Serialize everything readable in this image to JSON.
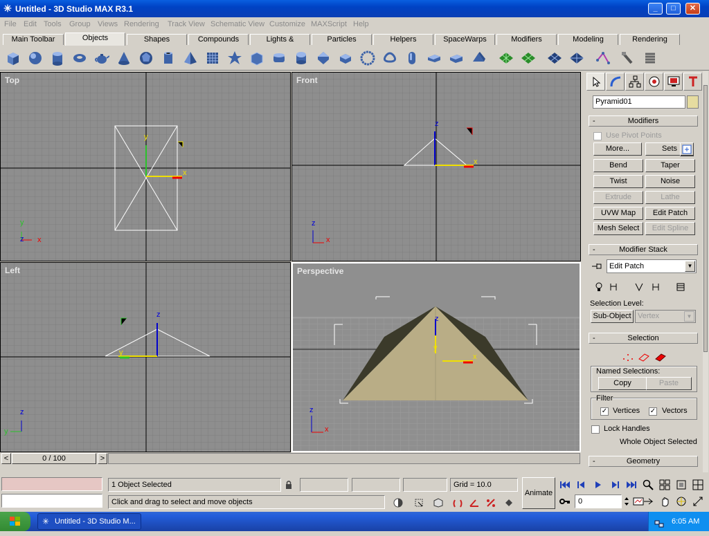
{
  "window": {
    "title": "Untitled - 3D Studio MAX R3.1",
    "minimize": "_",
    "maximize": "□",
    "close": "✕"
  },
  "menu": [
    "File",
    "Edit",
    "Tools",
    "Group",
    "Views",
    "Rendering",
    "Track View",
    "Schematic View",
    "Customize",
    "MAXScript",
    "Help"
  ],
  "tabs": [
    "Main Toolbar",
    "Objects",
    "Shapes",
    "Compounds",
    "Lights & Cameras",
    "Particles",
    "Helpers",
    "SpaceWarps",
    "Modifiers",
    "Modeling",
    "Rendering"
  ],
  "active_tab": "Objects",
  "viewports": {
    "top": "Top",
    "front": "Front",
    "left": "Left",
    "perspective": "Perspective"
  },
  "axes": {
    "x": "x",
    "y": "y",
    "z": "z"
  },
  "command_panel": {
    "object_name": "Pyramid01",
    "modifiers_title": "Modifiers",
    "use_pivot_points": "Use Pivot Points",
    "more": "More...",
    "sets": "Sets",
    "modifier_buttons": [
      {
        "label": "Bend",
        "enabled": true
      },
      {
        "label": "Taper",
        "enabled": true
      },
      {
        "label": "Twist",
        "enabled": true
      },
      {
        "label": "Noise",
        "enabled": true
      },
      {
        "label": "Extrude",
        "enabled": false
      },
      {
        "label": "Lathe",
        "enabled": false
      },
      {
        "label": "UVW Map",
        "enabled": true
      },
      {
        "label": "Edit Patch",
        "enabled": true
      },
      {
        "label": "Mesh Select",
        "enabled": true
      },
      {
        "label": "Edit Spline",
        "enabled": false
      }
    ],
    "modifier_stack_title": "Modifier Stack",
    "stack_value": "Edit Patch",
    "selection_level": "Selection Level:",
    "sub_object": "Sub-Object",
    "sub_object_value": "Vertex",
    "selection_title": "Selection",
    "named_selections": "Named Selections:",
    "copy": "Copy",
    "paste": "Paste",
    "filter": "Filter",
    "vertices": "Vertices",
    "vectors": "Vectors",
    "lock_handles": "Lock Handles",
    "whole_object_selected": "Whole Object Selected",
    "geometry_title": "Geometry",
    "rollout_minus": "-"
  },
  "timeline": {
    "frame": "0 / 100",
    "prev": "<",
    "next": ">"
  },
  "status": {
    "selected": "1 Object Selected",
    "prompt": "Click and drag to select and move objects",
    "grid": "Grid = 10.0",
    "animate": "Animate",
    "frame_value": "0"
  },
  "taskbar": {
    "item": "Untitled - 3D Studio M...",
    "clock": "6:05 AM"
  },
  "colors": {
    "viewport_bg": "#8e8e8e",
    "grid_line": "#7d7d7d",
    "axis_line": "#000000",
    "pyramid_face": "#b9ad86",
    "pyramid_dark": "#3b3a2a",
    "title_blue": "#0a5fe0"
  }
}
